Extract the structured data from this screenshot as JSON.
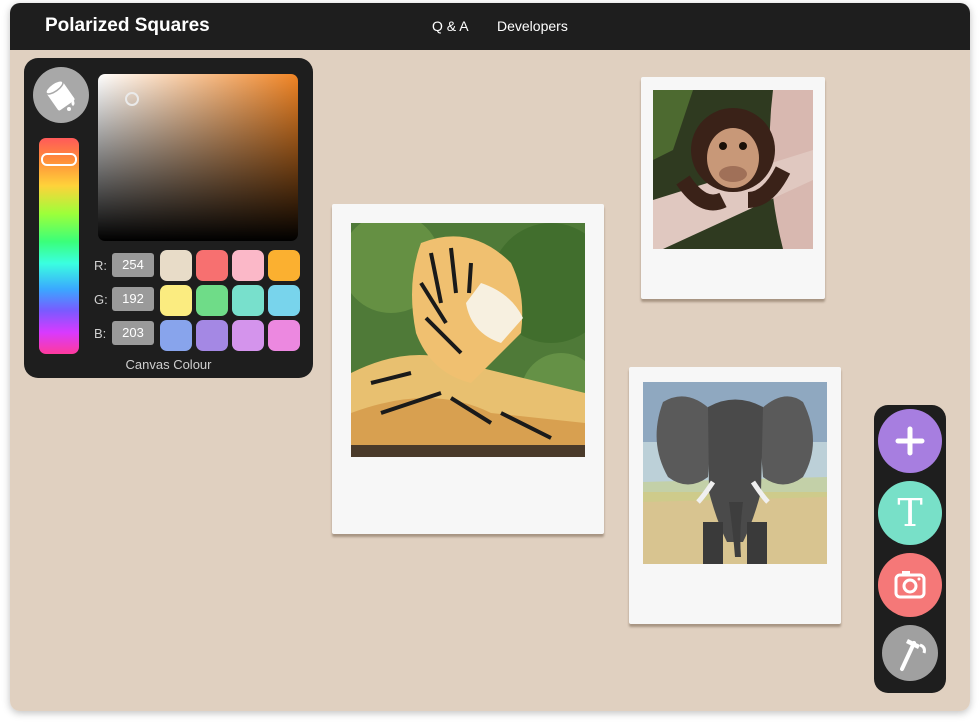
{
  "app": {
    "brand": "Polarized Squares",
    "nav": [
      {
        "label": "Q & A"
      },
      {
        "label": "Developers"
      }
    ]
  },
  "canvas": {
    "background": "#e0d0c0"
  },
  "color_picker": {
    "icon": "paint-bucket-icon",
    "rgb": [
      {
        "label": "R:",
        "value": "254"
      },
      {
        "label": "G:",
        "value": "192"
      },
      {
        "label": "B:",
        "value": "203"
      }
    ],
    "swatches": [
      "#e8dcc8",
      "#f77070",
      "#fbb8c8",
      "#fbb030",
      "#fbec80",
      "#6fdc88",
      "#78e0cc",
      "#78d4ec",
      "#88a4ec",
      "#a488e4",
      "#d494ec",
      "#ec88e0"
    ],
    "caption": "Canvas Colour"
  },
  "polaroids": [
    {
      "subject": "tiger drawing"
    },
    {
      "subject": "chimpanzee drawing"
    },
    {
      "subject": "elephant drawing"
    }
  ],
  "toolbar": {
    "items": [
      {
        "name": "add",
        "icon": "plus-icon",
        "color": "#a77ee0"
      },
      {
        "name": "text",
        "icon": "text-icon",
        "glyph": "T",
        "color": "#78e0c8"
      },
      {
        "name": "photo",
        "icon": "camera-icon",
        "color": "#f57878"
      },
      {
        "name": "hammer",
        "icon": "hammer-icon",
        "color": "#a0a0a0"
      }
    ]
  }
}
